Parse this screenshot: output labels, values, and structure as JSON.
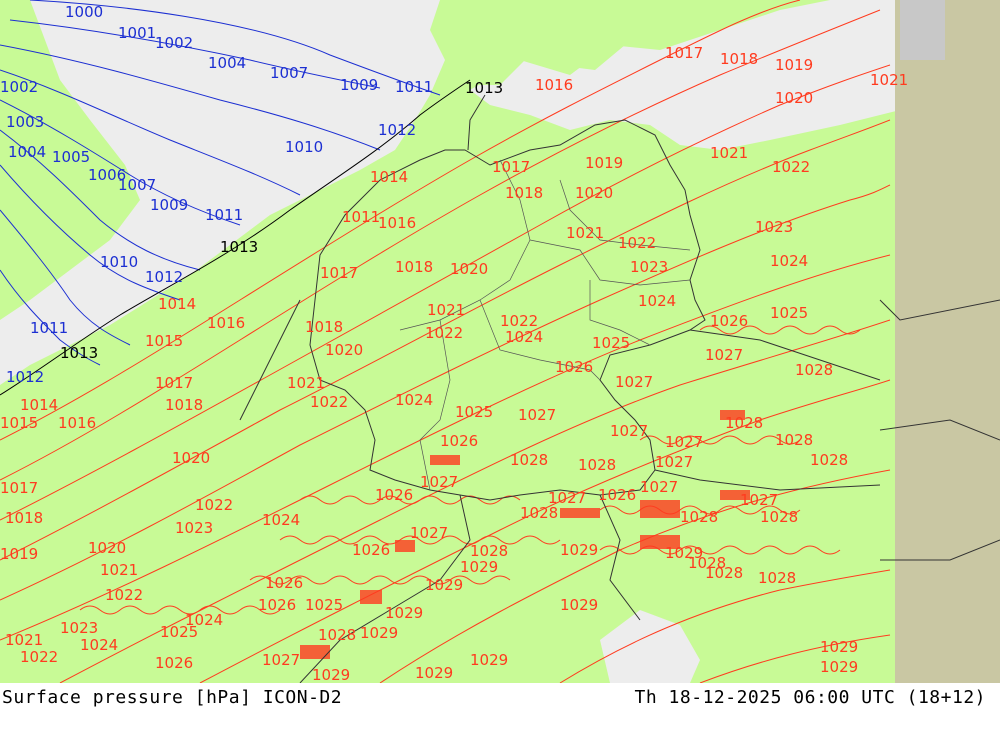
{
  "footer": {
    "left": "Surface pressure [hPa] ICON-D2",
    "right": "Th 18-12-2025 06:00 UTC (18+12)"
  },
  "colors": {
    "land": "#c8fa96",
    "sea": "#ededed",
    "out_of_domain": "#c9c7a3",
    "isobar_low": "#1c2fd2",
    "isobar_high": "#ff3b1f",
    "isobar_1013": "#000000",
    "borders": "#333333"
  },
  "map": {
    "reference_isobar_hpa": 1013,
    "isobar_labels": [
      {
        "v": "1000",
        "c": "blue"
      },
      {
        "v": "1001",
        "c": "blue"
      },
      {
        "v": "1002",
        "c": "blue"
      },
      {
        "v": "1003",
        "c": "blue"
      },
      {
        "v": "1004",
        "c": "blue"
      },
      {
        "v": "1005",
        "c": "blue"
      },
      {
        "v": "1006",
        "c": "blue"
      },
      {
        "v": "1007",
        "c": "blue"
      },
      {
        "v": "1008",
        "c": "blue"
      },
      {
        "v": "1009",
        "c": "blue"
      },
      {
        "v": "1010",
        "c": "blue"
      },
      {
        "v": "1011",
        "c": "blue"
      },
      {
        "v": "1012",
        "c": "blue"
      },
      {
        "v": "1013",
        "c": "black"
      },
      {
        "v": "1014",
        "c": "red"
      },
      {
        "v": "1015",
        "c": "red"
      },
      {
        "v": "1016",
        "c": "red"
      },
      {
        "v": "1017",
        "c": "red"
      },
      {
        "v": "1018",
        "c": "red"
      },
      {
        "v": "1019",
        "c": "red"
      },
      {
        "v": "1020",
        "c": "red"
      },
      {
        "v": "1021",
        "c": "red"
      },
      {
        "v": "1022",
        "c": "red"
      },
      {
        "v": "1023",
        "c": "red"
      },
      {
        "v": "1024",
        "c": "red"
      },
      {
        "v": "1025",
        "c": "red"
      },
      {
        "v": "1026",
        "c": "red"
      },
      {
        "v": "1027",
        "c": "red"
      },
      {
        "v": "1028",
        "c": "red"
      },
      {
        "v": "1029",
        "c": "red"
      }
    ]
  }
}
